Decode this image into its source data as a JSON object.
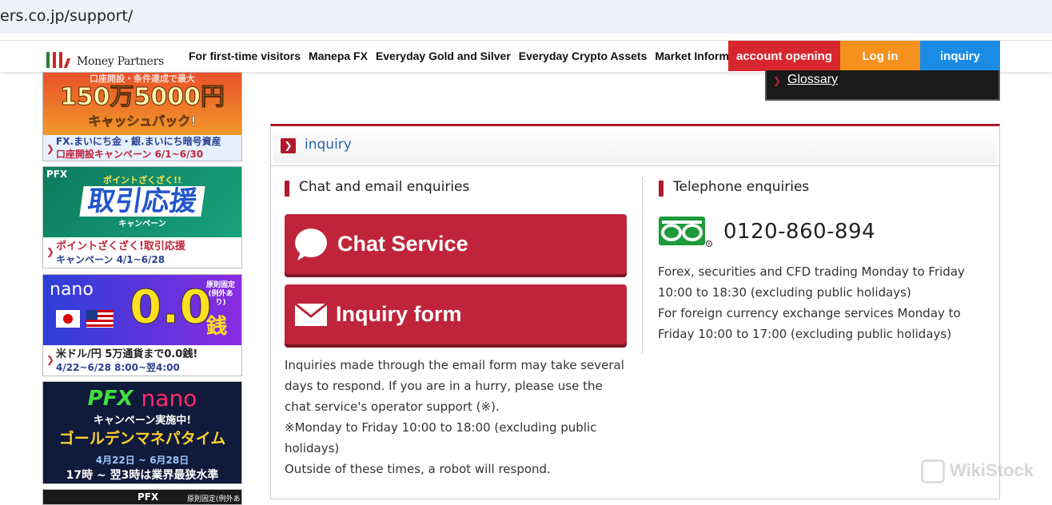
{
  "browser": {
    "url_fragment": "ers.co.jp/support/"
  },
  "header": {
    "logo_text": "Money Partners",
    "menu": [
      "For first-time visitors",
      "Manepa FX",
      "Everyday Gold and Silver",
      "Everyday Crypto Assets",
      "Market Informat"
    ],
    "account_opening": "account opening",
    "login": "Log in",
    "inquiry": "inquiry",
    "colors": {
      "account_opening": "#d7262d",
      "login": "#f7911e",
      "inquiry": "#1a8ce6"
    }
  },
  "glossary": {
    "label": "Glossary"
  },
  "sidebar": {
    "banners": [
      {
        "hero_top": "口座開設・条件達成で最大",
        "hero": "150万5000円",
        "hero_sub": "キャッシュバック!",
        "line1": "FX.まいにち金・銀.まいにち暗号資産",
        "line2": "口座開設キャンペーン 6/1~6/30"
      },
      {
        "tag": "PFX",
        "hero_top": "ポイントざくざく!!",
        "hero": "取引応援",
        "hero_sub": "キャンペーン",
        "line1": "ポイントざくざく!取引応援",
        "line2": "キャンペーン 4/1~6/28"
      },
      {
        "tag": "nano",
        "hero": "0.0",
        "hero_unit": "銭",
        "hero_note": "原則固定(例外あり)",
        "line1": "米ドル/円 5万通貨まで0.0銭!",
        "line2": "4/22~6/28 8:00~翌4:00"
      },
      {
        "tag": "PFX",
        "tag2": "nano",
        "hero_top": "キャンペーン実施中!",
        "hero": "ゴールデンマネパタイム",
        "line1": "4月22日 ~ 6月28日",
        "line2": "17時 ~ 翌3時は業界最狭水準"
      },
      {
        "tag": "PFX",
        "hero_note": "原則固定(例外あり)"
      }
    ]
  },
  "panel": {
    "title": "inquiry",
    "chat_section": {
      "title": "Chat and email enquiries",
      "chat_button": "Chat Service",
      "form_button": "Inquiry form",
      "note": [
        "Inquiries made through the email form may take several",
        "days to respond. If you are in a hurry, please use the",
        "chat service's operator support (※).",
        "※Monday to Friday 10:00 to 18:00 (excluding public",
        "holidays)",
        "Outside of these times, a robot will respond."
      ]
    },
    "phone_section": {
      "title": "Telephone enquiries",
      "phone": "0120-860-894",
      "hours": [
        "Forex, securities and CFD trading Monday to Friday",
        "10:00 to 18:30 (excluding public holidays)",
        "For foreign currency exchange services Monday to",
        "Friday 10:00 to 17:00 (excluding public holidays)"
      ]
    }
  },
  "watermark": "WikiStock"
}
